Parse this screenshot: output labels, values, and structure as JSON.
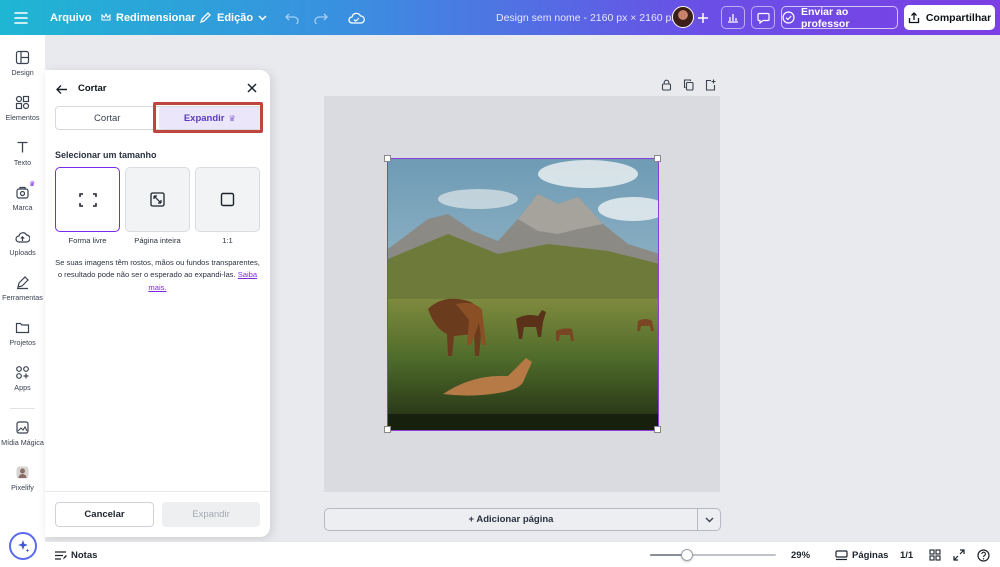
{
  "topbar": {
    "file_label": "Arquivo",
    "resize_label": "Redimensionar",
    "edit_label": "Edição",
    "design_title": "Design sem nome - 2160 px × 2160 px",
    "send_teacher_label": "Enviar ao professor",
    "share_label": "Compartilhar"
  },
  "sidebar": {
    "items": [
      {
        "label": "Design",
        "icon": "layout-icon"
      },
      {
        "label": "Elementos",
        "icon": "shapes-icon"
      },
      {
        "label": "Texto",
        "icon": "text-icon"
      },
      {
        "label": "Marca",
        "icon": "brand-icon"
      },
      {
        "label": "Uploads",
        "icon": "cloud-upload-icon"
      },
      {
        "label": "Ferramentas",
        "icon": "pen-tool-icon"
      },
      {
        "label": "Projetos",
        "icon": "folder-icon"
      },
      {
        "label": "Apps",
        "icon": "apps-grid-icon"
      },
      {
        "label": "Mídia Mágica",
        "icon": "magic-media-icon"
      },
      {
        "label": "Pixelify",
        "icon": "pixelify-icon"
      }
    ]
  },
  "panel": {
    "title": "Cortar",
    "tabs": [
      {
        "label": "Cortar",
        "active": false
      },
      {
        "label": "Expandir",
        "active": true
      }
    ],
    "section_label": "Selecionar um tamanho",
    "size_options": [
      {
        "label": "Forma livre",
        "icon": "freeform-icon",
        "selected": true
      },
      {
        "label": "Página inteira",
        "icon": "full-page-icon",
        "selected": false
      },
      {
        "label": "1:1",
        "icon": "square-icon",
        "selected": false
      }
    ],
    "info_text": "Se suas imagens têm rostos, mãos ou fundos transparentes, o resultado pode não ser o esperado ao expandi-las.",
    "info_link": "Saiba mais.",
    "cancel_label": "Cancelar",
    "expand_label": "Expandir"
  },
  "canvas": {
    "add_page_label": "+ Adicionar página"
  },
  "bottombar": {
    "notes_label": "Notas",
    "zoom": "29%",
    "zoom_fraction": 0.29,
    "pages_label": "Páginas",
    "page_count": "1/1"
  },
  "colors": {
    "accent": "#7d2ae8",
    "highlight_box": "#c0453f"
  }
}
